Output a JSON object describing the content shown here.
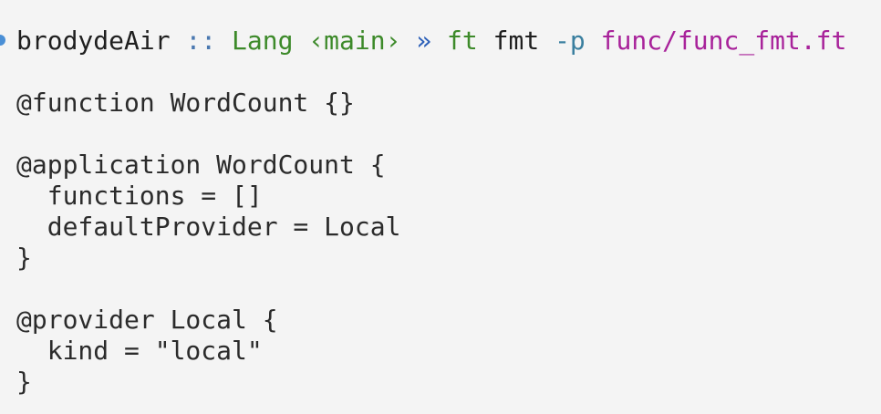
{
  "colors": {
    "background": "#f4f4f4",
    "marker": "#4a8fd6",
    "host": "#1f1f1f",
    "separator": "#4a78b0",
    "directory": "#3d8a2a",
    "branch": "#3d8a2a",
    "arrow": "#2b5fb8",
    "command": "#3d8a2a",
    "flag": "#3a7f9f",
    "path": "#a8229a",
    "output": "#2b2b2b"
  },
  "prompt": {
    "host": "brodydeAir",
    "separator": "::",
    "directory": "Lang",
    "branch": "‹main›",
    "arrow": "»",
    "command": "ft",
    "subcommand": "fmt",
    "flag": "-p",
    "path": "func/func_fmt.ft"
  },
  "output": [
    "@function WordCount {}",
    "",
    "@application WordCount {",
    "  functions = []",
    "  defaultProvider = Local",
    "}",
    "",
    "@provider Local {",
    "  kind = \"local\"",
    "}"
  ]
}
